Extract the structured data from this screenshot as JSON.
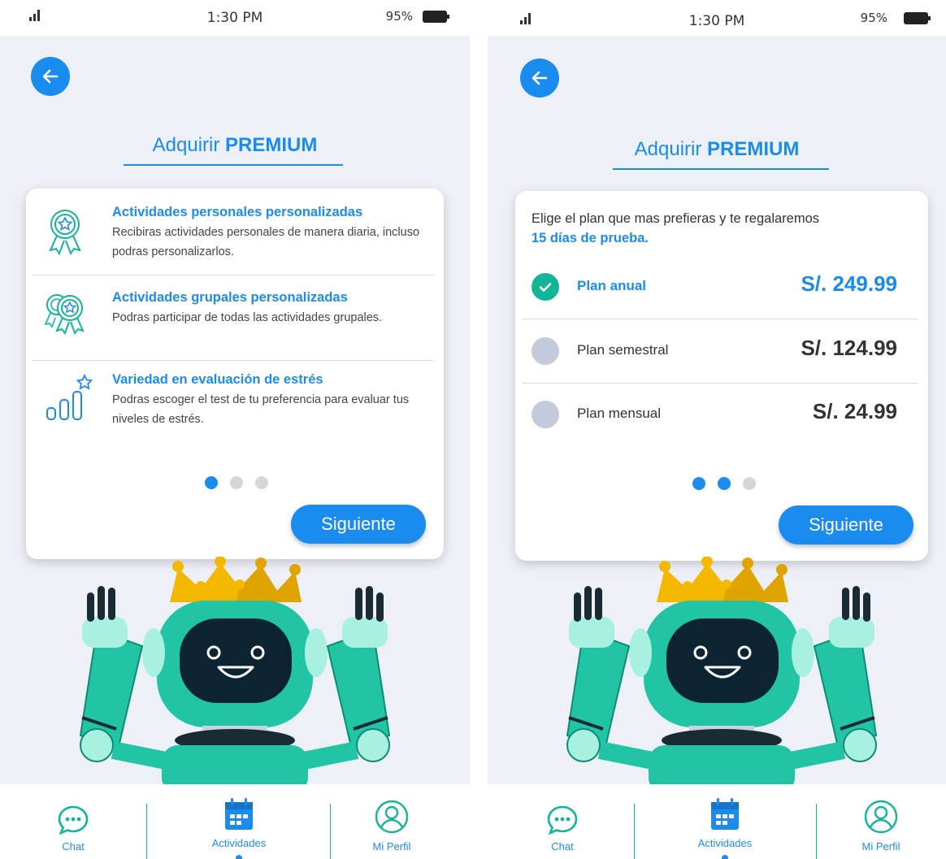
{
  "colors": {
    "accent": "#1a8cf0",
    "teal": "#12b598",
    "background": "#eef0f8",
    "inactive_radio": "#c4c9dc"
  },
  "status_bar": {
    "time": "1:30 PM",
    "battery_pct": "95%"
  },
  "header": {
    "title_prefix": "Adquirir ",
    "title_bold": "PREMIUM"
  },
  "screen1": {
    "features": [
      {
        "icon": "award-badge-icon",
        "title": "Actividades personales personalizadas",
        "desc": "Recibiras actividades personales de manera diaria, incluso podras personalizarlos."
      },
      {
        "icon": "double-award-icon",
        "title": "Actividades grupales personalizadas",
        "desc": "Podras participar de todas las actividades grupales."
      },
      {
        "icon": "bar-chart-star-icon",
        "title": "Variedad en evaluación de estrés",
        "desc": "Podras escoger el test de tu preferencia para evaluar tus niveles de estrés."
      }
    ],
    "pagination": {
      "total": 3,
      "current": 1
    },
    "next_label": "Siguiente"
  },
  "screen2": {
    "intro": "Elige el plan que mas prefieras y te regalaremos",
    "intro_highlight": "15 días de prueba.",
    "plans": [
      {
        "name": "Plan anual",
        "price": "S/. 249.99",
        "selected": true
      },
      {
        "name": "Plan semestral",
        "price": "S/. 124.99",
        "selected": false
      },
      {
        "name": "Plan mensual",
        "price": "S/. 24.99",
        "selected": false
      }
    ],
    "pagination": {
      "total": 3,
      "current": 2
    },
    "next_label": "Siguiente"
  },
  "nav": {
    "items": [
      {
        "label": "Chat",
        "icon": "chat-bubble-icon"
      },
      {
        "label": "Actividades",
        "icon": "calendar-icon",
        "active": true
      },
      {
        "label": "Mi Perfil",
        "icon": "user-profile-icon"
      }
    ]
  }
}
